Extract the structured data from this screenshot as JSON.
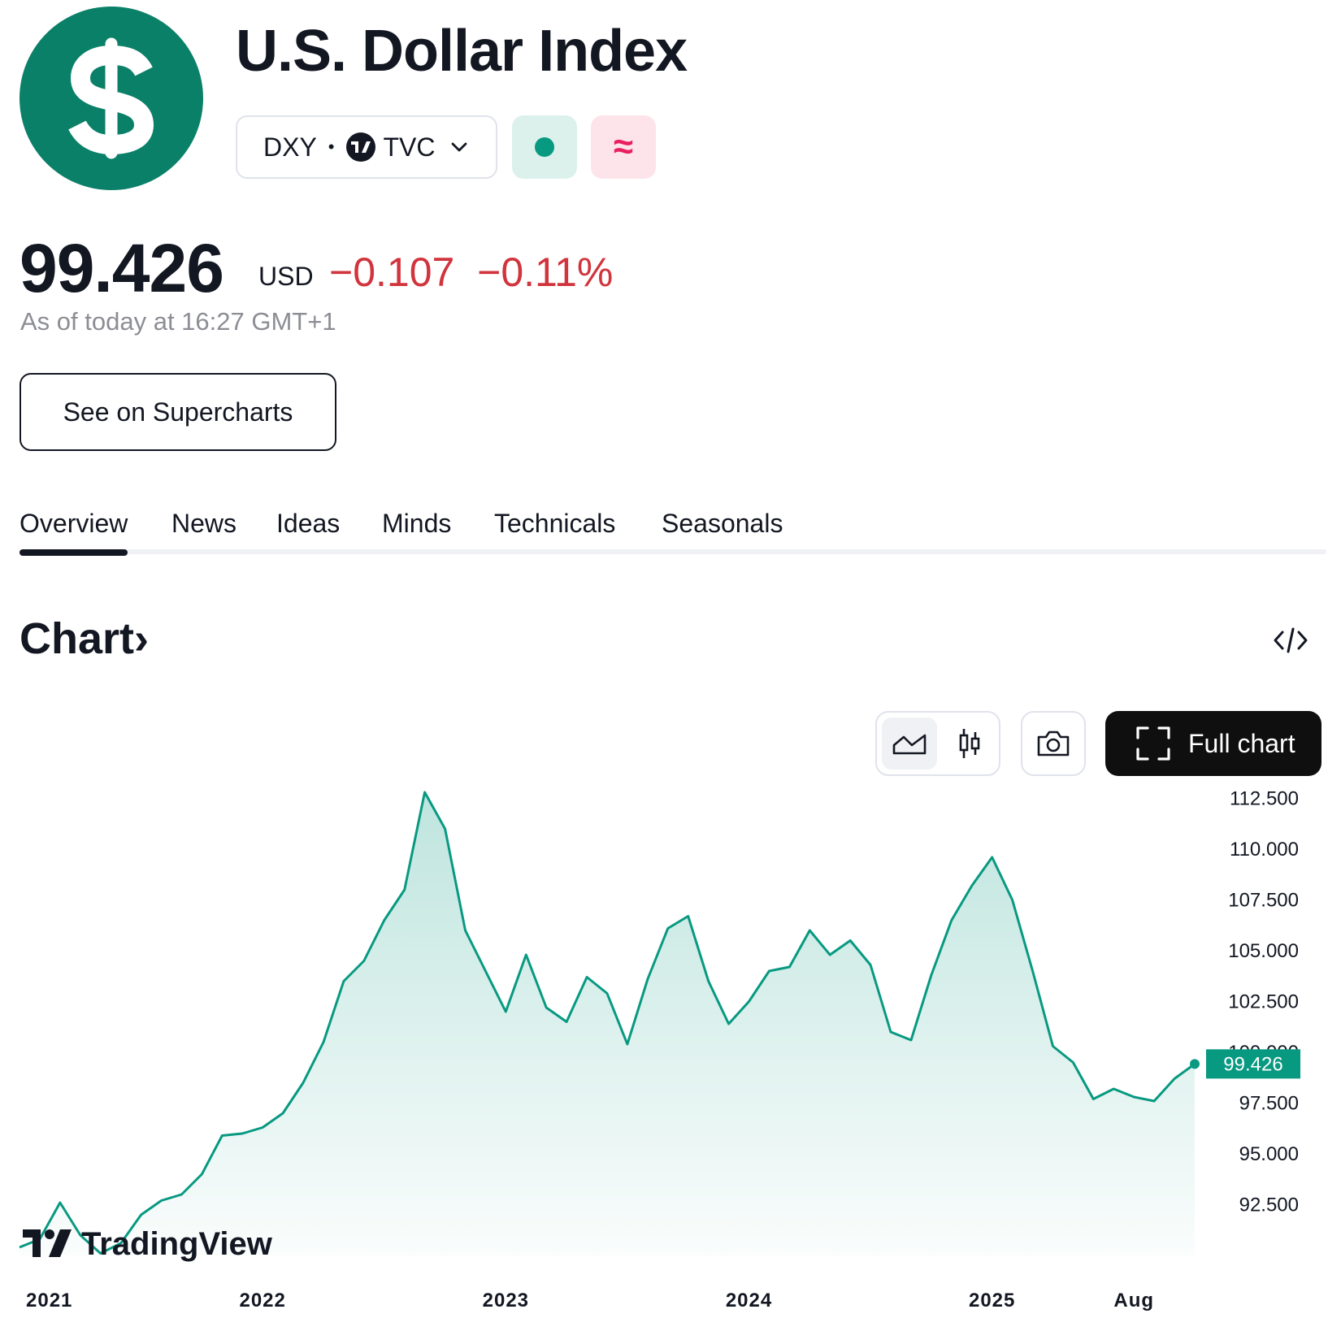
{
  "header": {
    "logo_symbol": "$",
    "title": "U.S. Dollar Index",
    "ticker": "DXY",
    "exchange": "TVC",
    "exchange_badge": "17",
    "delay_symbol": "≈"
  },
  "quote": {
    "price": "99.426",
    "currency": "USD",
    "change": "−0.107",
    "change_percent": "−0.11%",
    "as_of": "As of today at 16:27 GMT+1"
  },
  "actions": {
    "supercharts_label": "See on Supercharts"
  },
  "tabs": [
    {
      "label": "Overview",
      "active": true
    },
    {
      "label": "News"
    },
    {
      "label": "Ideas"
    },
    {
      "label": "Minds"
    },
    {
      "label": "Technicals"
    },
    {
      "label": "Seasonals"
    }
  ],
  "chart_section": {
    "heading": "Chart",
    "heading_chevron": "›",
    "full_chart_label": "Full chart",
    "watermark": "TradingView"
  },
  "colors": {
    "accent": "#089981",
    "negative": "#d1343c",
    "logo_bg": "#0b8068",
    "price_tag": "#089981"
  },
  "icons": [
    "dollar-icon",
    "chevron-down-icon",
    "embed-code-icon",
    "area-chart-icon",
    "candlestick-icon",
    "camera-icon",
    "fullscreen-icon"
  ],
  "chart_data": {
    "type": "area",
    "title": "",
    "xlabel": "",
    "ylabel": "",
    "x_ticks": [
      "2021",
      "2022",
      "2023",
      "2024",
      "2025",
      "Aug"
    ],
    "y_ticks": [
      "112.500",
      "110.000",
      "107.500",
      "105.000",
      "102.500",
      "100.000",
      "97.500",
      "95.000",
      "92.500"
    ],
    "ylim": [
      90.0,
      113.4
    ],
    "last_value_label": "99.426",
    "series": [
      {
        "x": [
          "2021-01",
          "2021-02",
          "2021-03",
          "2021-04",
          "2021-05",
          "2021-06",
          "2021-07",
          "2021-08",
          "2021-09",
          "2021-10",
          "2021-11",
          "2021-12",
          "2022-01",
          "2022-02",
          "2022-03",
          "2022-04",
          "2022-05",
          "2022-06",
          "2022-07",
          "2022-08",
          "2022-09",
          "2022-10",
          "2022-11",
          "2022-12",
          "2023-01",
          "2023-02",
          "2023-03",
          "2023-04",
          "2023-05",
          "2023-06",
          "2023-07",
          "2023-08",
          "2023-09",
          "2023-10",
          "2023-11",
          "2023-12",
          "2024-01",
          "2024-02",
          "2024-03",
          "2024-04",
          "2024-05",
          "2024-06",
          "2024-07",
          "2024-08",
          "2024-09",
          "2024-10",
          "2024-11",
          "2024-12",
          "2025-01",
          "2025-02",
          "2025-03",
          "2025-04",
          "2025-05",
          "2025-06",
          "2025-07",
          "2025-08",
          "2025-09",
          "2025-10",
          "2025-11"
        ],
        "values": [
          90.4,
          90.8,
          92.6,
          91.0,
          90.1,
          90.6,
          92.0,
          92.7,
          93.0,
          94.0,
          95.9,
          96.0,
          96.3,
          97.0,
          98.5,
          100.5,
          103.5,
          104.5,
          106.5,
          108.0,
          112.8,
          111.0,
          106.0,
          104.0,
          102.0,
          104.8,
          102.2,
          101.5,
          103.7,
          102.9,
          100.4,
          103.6,
          106.1,
          106.7,
          103.5,
          101.4,
          102.5,
          104.0,
          104.2,
          106.0,
          104.8,
          105.5,
          104.3,
          101.0,
          100.6,
          103.8,
          106.5,
          108.2,
          109.6,
          107.5,
          104.0,
          100.3,
          99.5,
          97.7,
          98.2,
          97.8,
          97.6,
          98.7,
          99.426
        ]
      }
    ]
  }
}
